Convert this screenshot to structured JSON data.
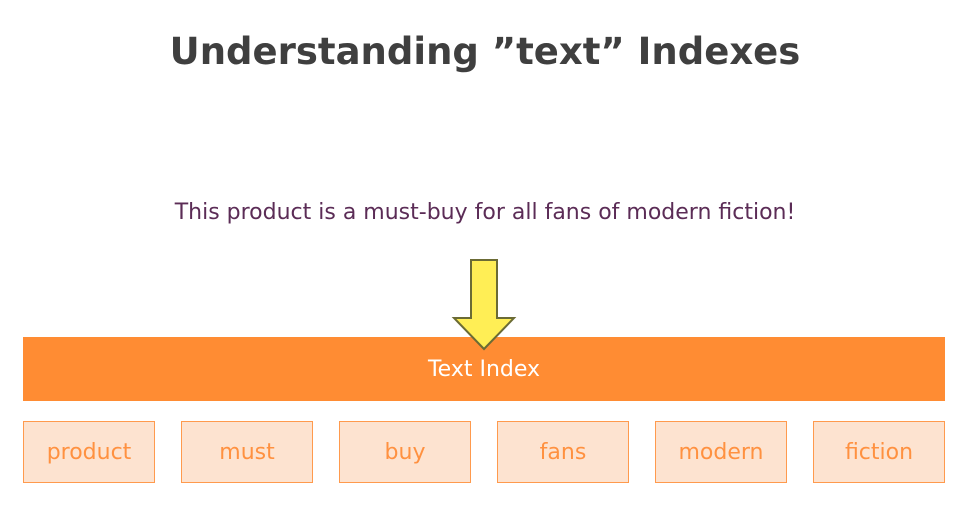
{
  "slide": {
    "title": "Understanding ”text” Indexes",
    "sentence": "This product is a must-buy for all fans of modern fiction!",
    "index_label": "Text Index",
    "tokens": [
      "product",
      "must",
      "buy",
      "fans",
      "modern",
      "fiction"
    ]
  },
  "colors": {
    "title": "#3f3f3f",
    "sentence": "#5b2c56",
    "index_bar": "#ff8c33",
    "token_fill": "#fde3d0",
    "token_border": "#ff9a4d",
    "token_text": "#ff9140",
    "arrow_fill": "#ffee55",
    "arrow_stroke": "#6b6b35"
  },
  "icons": {
    "arrow": "down-arrow-icon"
  }
}
